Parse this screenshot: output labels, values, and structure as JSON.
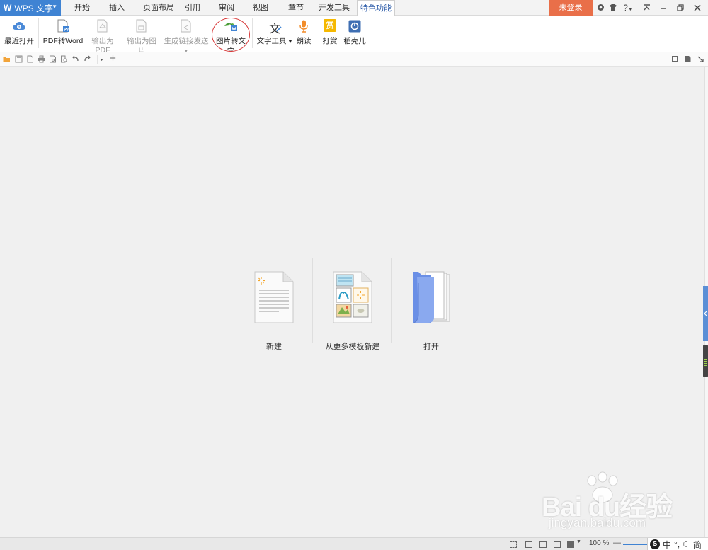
{
  "app": {
    "name": "WPS 文字",
    "logo": "W"
  },
  "tabs": [
    "开始",
    "插入",
    "页面布局",
    "引用",
    "审阅",
    "视图",
    "章节",
    "开发工具",
    "特色功能"
  ],
  "active_tab": "特色功能",
  "login": "未登录",
  "window_controls": {
    "help": "?"
  },
  "ribbon": {
    "recent_open": "最近打开",
    "pdf_to_word": "PDF转Word",
    "export_pdf": "输出为PDF",
    "export_image": "输出为图片",
    "share_link": "生成链接发送",
    "image_to_text": "图片转文字",
    "text_tools": "文字工具",
    "read_aloud": "朗读",
    "reward": "打赏",
    "docer": "稻壳儿",
    "reward_glyph": "赏",
    "text_tools_glyph": "文"
  },
  "start": {
    "new": "新建",
    "new_from_template": "从更多模板新建",
    "open": "打开"
  },
  "status": {
    "zoom": "100 %"
  },
  "ime": {
    "logo": "S",
    "mode": "中",
    "punct": "°,",
    "simplified": "简"
  },
  "watermark": {
    "brand": "Bai du经验",
    "url": "jingyan.baidu.com"
  },
  "colors": {
    "accent": "#3f83d3",
    "login": "#e96f49",
    "highlight": "#d83a3a"
  }
}
